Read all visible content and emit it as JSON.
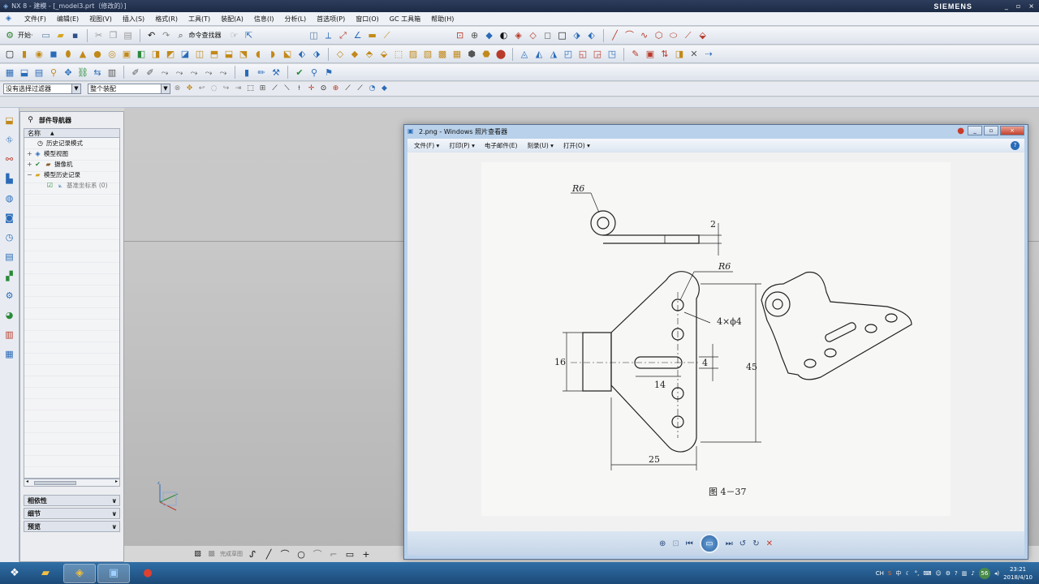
{
  "app": {
    "title": "NX 8 - 建模 - [_model3.prt（修改的）]",
    "brand": "SIEMENS",
    "window_controls": [
      "_",
      "▫",
      "×"
    ]
  },
  "menubar": [
    "文件(F)",
    "编辑(E)",
    "视图(V)",
    "插入(S)",
    "格式(R)",
    "工具(T)",
    "装配(A)",
    "信息(I)",
    "分析(L)",
    "首选项(P)",
    "窗口(O)",
    "GC 工具箱",
    "帮助(H)"
  ],
  "toolbar1": {
    "start_label": "开始·",
    "command_finder_label": "命令查找器"
  },
  "selection_bar": {
    "filter_value": "没有选择过滤器",
    "scope_value": "整个装配"
  },
  "navigator": {
    "title": "部件导航器",
    "column_name": "名称",
    "sort_arrow": "▲",
    "nodes": [
      {
        "label": "历史记录模式",
        "icon": "clock-icon",
        "indent": 1
      },
      {
        "label": "模型视图",
        "icon": "views-icon",
        "indent": 0,
        "expand": "+"
      },
      {
        "label": "摄像机",
        "icon": "camera-icon",
        "indent": 0,
        "expand": "+"
      },
      {
        "label": "模型历史记录",
        "icon": "folder-icon",
        "indent": 0,
        "expand": "−"
      },
      {
        "label": "基准坐标系 (0)",
        "icon": "csys-icon",
        "indent": 2
      }
    ],
    "panels": [
      "相依性",
      "细节",
      "预览"
    ]
  },
  "viewer": {
    "title": "2.png - Windows 照片查看器",
    "menu": [
      "文件(F) ▾",
      "打印(P) ▾",
      "电子邮件(E)",
      "刻录(U) ▾",
      "打开(O) ▾"
    ],
    "help": "?"
  },
  "drawing": {
    "r6_top": "R6",
    "r6_mid": "R6",
    "dim_2": "2",
    "holes": "4×ϕ4",
    "dim_16": "16",
    "dim_14": "14",
    "dim_4": "4",
    "dim_45": "45",
    "dim_25": "25",
    "caption": "图  4－37"
  },
  "sketchbar": {
    "label": "完成草图"
  },
  "taskbar": {
    "lang": "CH",
    "badge": "56",
    "time": "23:21",
    "date": "2018/4/10"
  },
  "colors": {
    "accent": "#2f6fa6",
    "viewer_frame": "#b9d1ea"
  }
}
